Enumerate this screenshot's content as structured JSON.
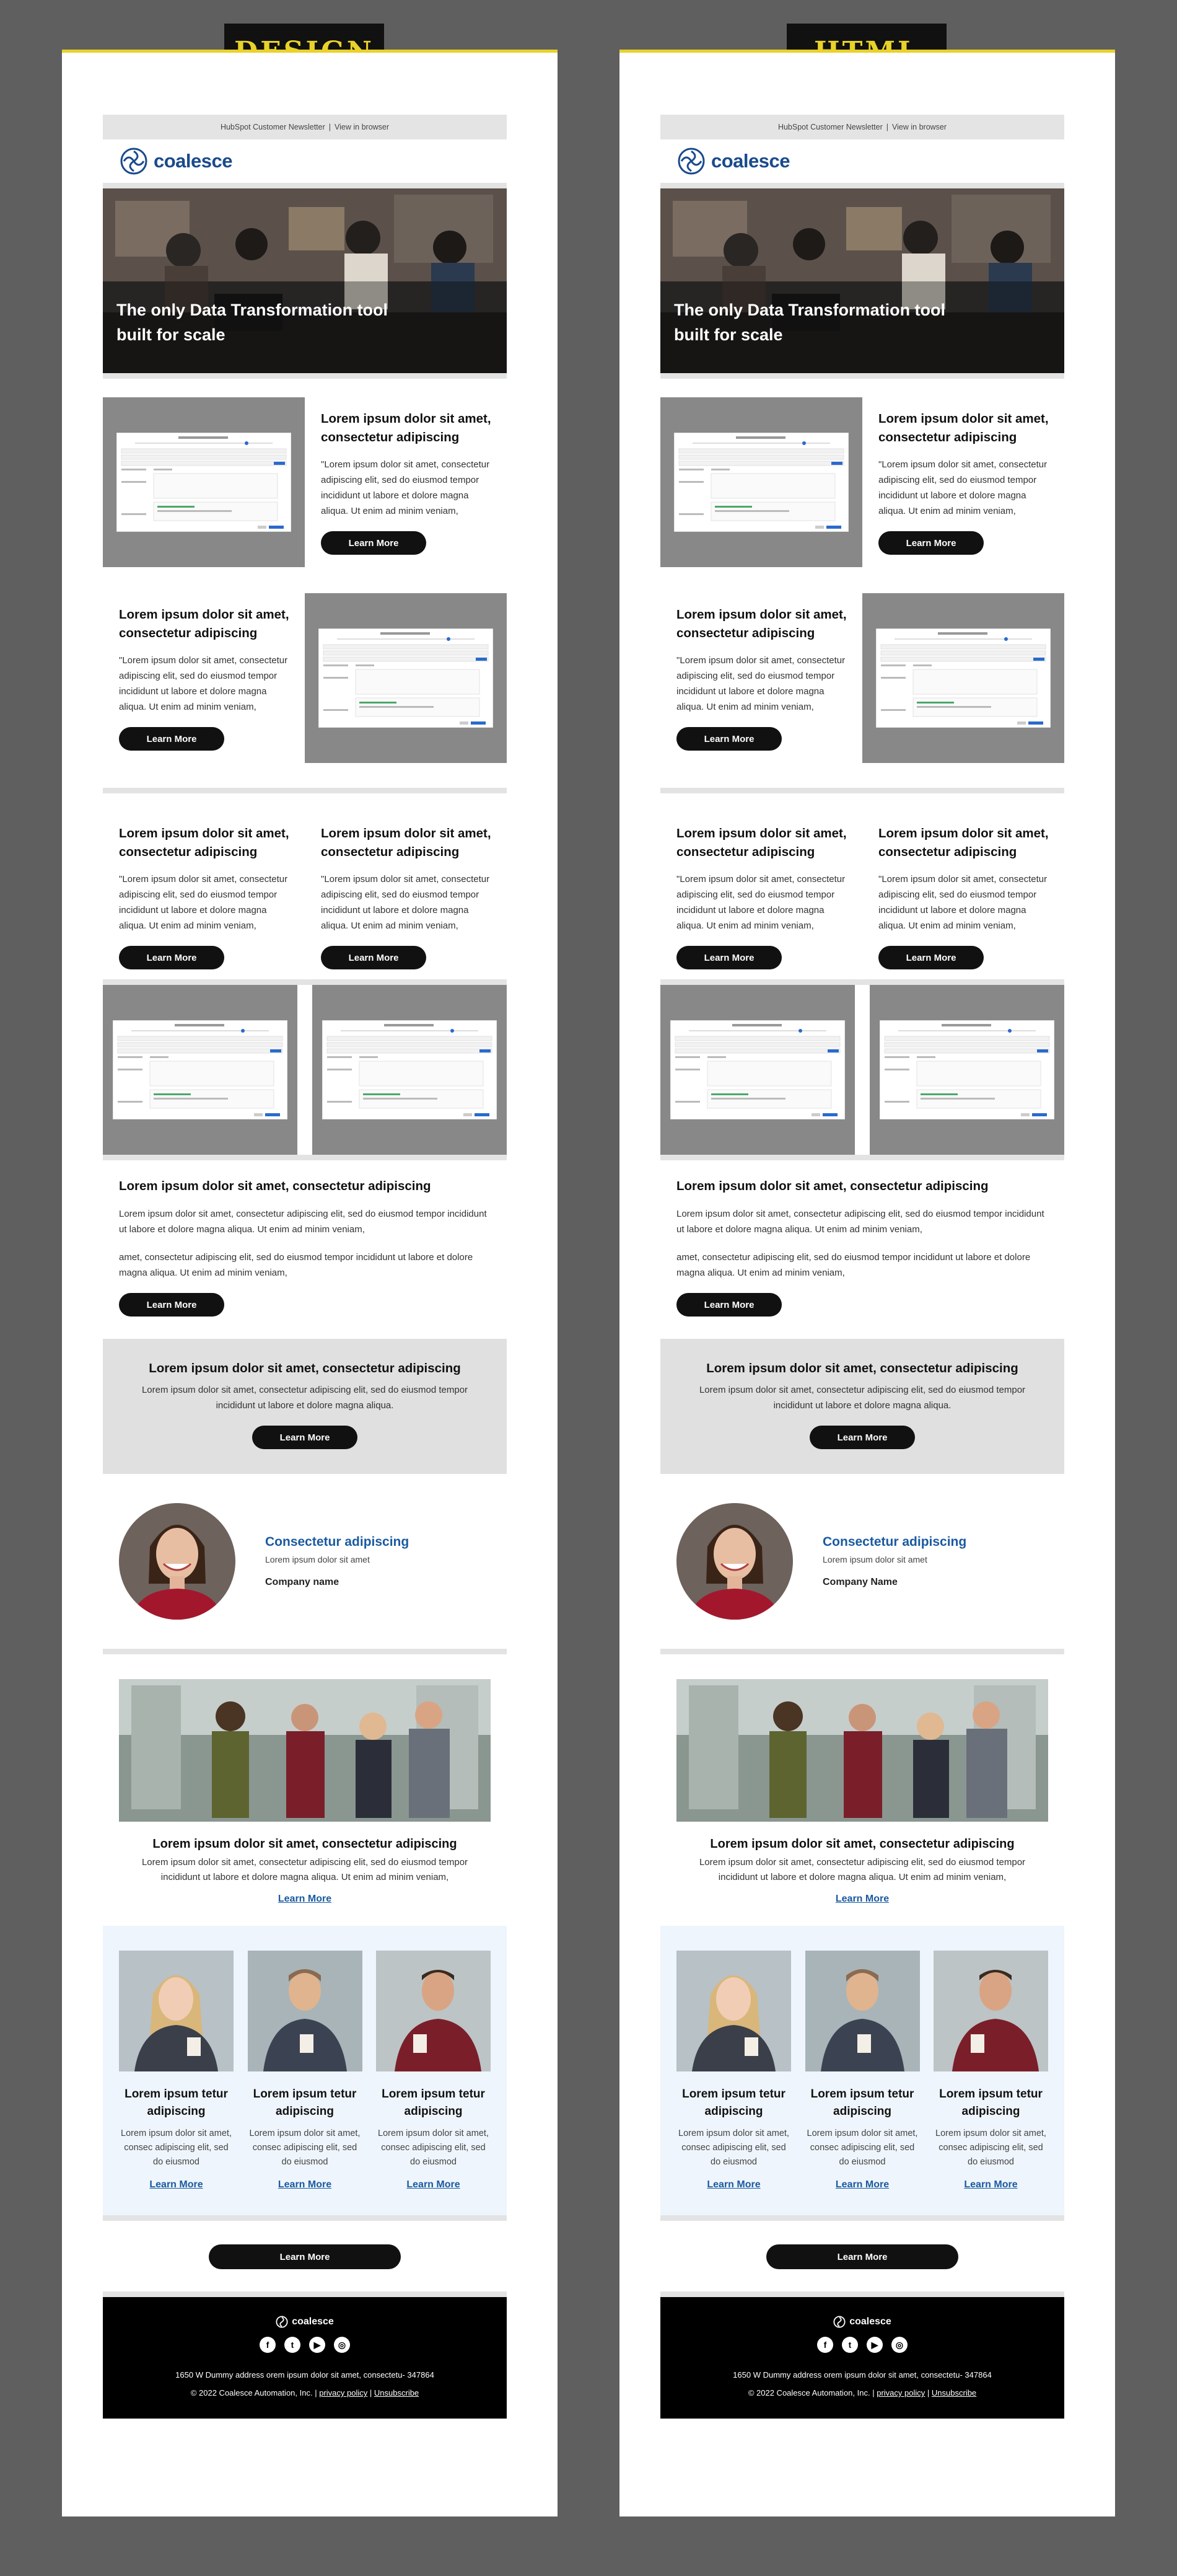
{
  "labels": {
    "design": "DESIGN",
    "html": "HTML"
  },
  "colors": {
    "background": "#5f5f5f",
    "label_bg": "#111111",
    "label_text": "#e9d229",
    "brand": "#1a4a8c",
    "link": "#1a5aa0",
    "cta_gray": "#e0e0e0",
    "card_bg": "#eef5fc"
  },
  "newsletter": {
    "topbar": {
      "left": "HubSpot Customer Newsletter",
      "divider": "|",
      "right": "View in browser"
    },
    "logo": {
      "word": "coalesce",
      "icon": "coalesce-spiral-icon"
    },
    "hero": {
      "line1": "The only Data Transformation tool",
      "line2": "built for scale"
    },
    "feature": {
      "title": "Lorem ipsum dolor sit amet, consectetur adipiscing",
      "body": "\"Lorem ipsum dolor sit amet, consectetur adipiscing elit, sed do eiusmod tempor incididunt ut labore et dolore magna aliqua. Ut enim ad minim veniam,",
      "button": "Learn More"
    },
    "wide": {
      "title": "Lorem ipsum dolor sit amet, consectetur adipiscing",
      "p1": "Lorem ipsum dolor sit amet, consectetur adipiscing elit, sed do eiusmod tempor incididunt ut labore et dolore magna aliqua. Ut enim ad minim veniam,",
      "p2": "amet, consectetur adipiscing elit, sed do eiusmod tempor incididunt ut labore et dolore magna aliqua. Ut enim ad minim veniam,",
      "button": "Learn More"
    },
    "cta": {
      "title": "Lorem ipsum dolor sit amet, consectetur adipiscing",
      "body": "Lorem ipsum dolor sit amet, consectetur adipiscing elit, sed do eiusmod tempor incididunt ut labore et dolore magna aliqua.",
      "button": "Learn More"
    },
    "person": {
      "name": "Consectetur adipiscing",
      "role": "Lorem ipsum dolor sit amet",
      "company_design": "Company name",
      "company_html": "Company Name"
    },
    "team": {
      "title": "Lorem ipsum dolor sit amet, consectetur adipiscing",
      "body": "Lorem ipsum dolor sit amet, consectetur adipiscing elit, sed do eiusmod tempor incididunt ut labore et dolore magna aliqua. Ut enim ad minim veniam,",
      "link": "Learn More"
    },
    "cards": [
      {
        "title": "Lorem ipsum tetur adipiscing",
        "body": "Lorem ipsum dolor sit amet, consec adipiscing elit, sed do eiusmod",
        "link": "Learn More"
      },
      {
        "title": "Lorem ipsum tetur adipiscing",
        "body": "Lorem ipsum dolor sit amet, consec adipiscing elit, sed do eiusmod",
        "link": "Learn More"
      },
      {
        "title": "Lorem ipsum tetur adipiscing",
        "body": "Lorem ipsum dolor sit amet, consec adipiscing elit, sed do eiusmod",
        "link": "Learn More"
      }
    ],
    "bottom_button": "Learn More",
    "footer": {
      "logo": "coalesce",
      "social": [
        "f",
        "t",
        "▶",
        "◎"
      ],
      "social_icons": [
        "facebook-icon",
        "twitter-icon",
        "youtube-icon",
        "instagram-icon"
      ],
      "address": "1650 W Dummy address orem ipsum dolor sit amet, consectetu- 347864",
      "copyright": "© 2022 Coalesce Automation, Inc.",
      "privacy": "privacy policy",
      "unsubscribe": "Unsubscribe",
      "divider": "|"
    }
  }
}
